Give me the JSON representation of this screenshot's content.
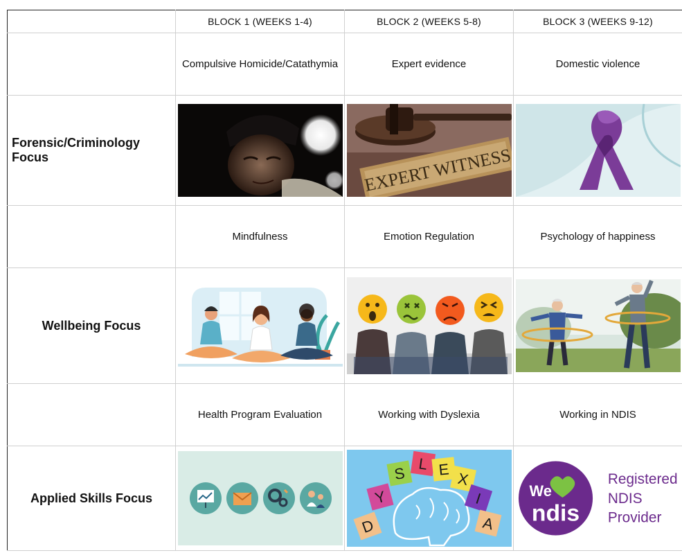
{
  "header": {
    "blank": "",
    "block1": "BLOCK 1 (WEEKS 1-4)",
    "block2": "BLOCK 2  (WEEKS 5-8)",
    "block3": "BLOCK 3  (WEEKS 9-12)"
  },
  "forensic": {
    "label": "Forensic/Criminology Focus",
    "topics": [
      "Compulsive Homicide/Catathymia",
      "Expert evidence",
      "Domestic violence"
    ],
    "images": {
      "sign_text": "EXPERT WITNESS"
    }
  },
  "wellbeing": {
    "label": "Wellbeing Focus",
    "topics": [
      "Mindfulness",
      "Emotion Regulation",
      "Psychology of happiness"
    ]
  },
  "applied": {
    "label": "Applied Skills Focus",
    "topics": [
      "Health Program Evaluation",
      "Working with Dyslexia",
      "Working in NDIS"
    ],
    "images": {
      "dyslexia_letters": [
        "D",
        "Y",
        "S",
        "L",
        "E",
        "X",
        "I",
        "A"
      ],
      "ndis_we": "We",
      "ndis_word": "ndis",
      "ndis_caption": [
        "Registered",
        "NDIS",
        "Provider"
      ]
    }
  },
  "colors": {
    "ndis_purple": "#6b2a8c",
    "ndis_green": "#7cc243",
    "ribbon_purple": "#7b3c98",
    "gavel_brown": "#4a2c1e"
  }
}
